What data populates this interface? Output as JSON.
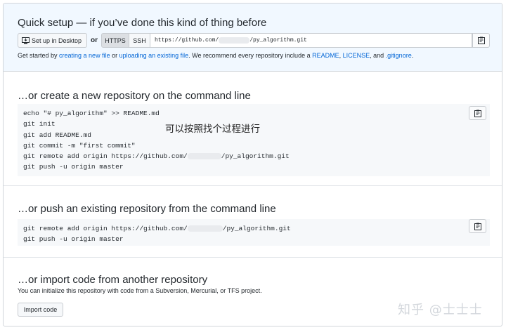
{
  "quick_setup": {
    "title": "Quick setup — if you’ve done this kind of thing before",
    "desktop_button": "Set up in Desktop",
    "or_label": "or",
    "https_label": "HTTPS",
    "ssh_label": "SSH",
    "url_prefix": "https://github.com/",
    "url_suffix": "/py_algorithm.git",
    "info": {
      "t1": "Get started by ",
      "link_new_file": "creating a new file",
      "t2": " or ",
      "link_upload": "uploading an existing file",
      "t3": ". We recommend every repository include a ",
      "link_readme": "README",
      "t4": ", ",
      "link_license": "LICENSE",
      "t5": ", and ",
      "link_gitignore": ".gitignore",
      "t6": "."
    }
  },
  "create_section": {
    "title": "…or create a new repository on the command line",
    "lines": [
      "echo \"# py_algorithm\" >> README.md",
      "git init",
      "git add README.md",
      "git commit -m \"first commit\"",
      "git remote add origin https://github.com/",
      "git push -u origin master"
    ],
    "remote_suffix": "/py_algorithm.git",
    "annotation": "可以按照找个过程进行"
  },
  "push_section": {
    "title": "…or push an existing repository from the command line",
    "lines": [
      "git remote add origin https://github.com/",
      "git push -u origin master"
    ],
    "remote_suffix": "/py_algorithm.git"
  },
  "import_section": {
    "title": "…or import code from another repository",
    "description": "You can initialize this repository with code from a Subversion, Mercurial, or TFS project.",
    "button": "Import code"
  },
  "watermark": "知乎 @士士士",
  "colors": {
    "link": "#0366d6",
    "quick_bg": "#f1f8ff",
    "code_bg": "#f6f8fa"
  }
}
